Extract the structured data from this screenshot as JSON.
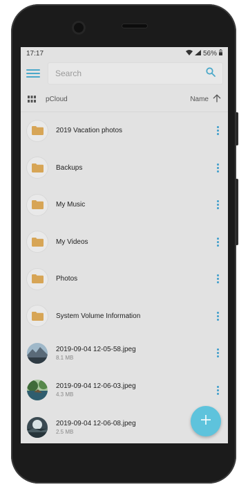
{
  "status": {
    "time": "17:17",
    "battery": "56%"
  },
  "header": {
    "search_placeholder": "Search"
  },
  "sortbar": {
    "location": "pCloud",
    "sort_label": "Name"
  },
  "items": [
    {
      "name": "2019 Vacation photos",
      "type": "folder",
      "size": ""
    },
    {
      "name": "Backups",
      "type": "folder",
      "size": ""
    },
    {
      "name": "My Music",
      "type": "folder",
      "size": ""
    },
    {
      "name": "My Videos",
      "type": "folder",
      "size": ""
    },
    {
      "name": "Photos",
      "type": "folder",
      "size": ""
    },
    {
      "name": "System Volume Information",
      "type": "folder",
      "size": ""
    },
    {
      "name": "2019-09-04 12-05-58.jpeg",
      "type": "image",
      "size": "8.1 MB"
    },
    {
      "name": "2019-09-04 12-06-03.jpeg",
      "type": "image",
      "size": "4.3 MB"
    },
    {
      "name": "2019-09-04 12-06-08.jpeg",
      "type": "image",
      "size": "2.5 MB"
    }
  ],
  "colors": {
    "accent": "#4aa8c9",
    "fab": "#5ec3dc",
    "folder": "#d7a556"
  },
  "icons": [
    "menu-icon",
    "search-icon",
    "grid-view-icon",
    "sort-arrow-up-icon",
    "folder-icon",
    "more-vert-icon",
    "add-icon"
  ]
}
